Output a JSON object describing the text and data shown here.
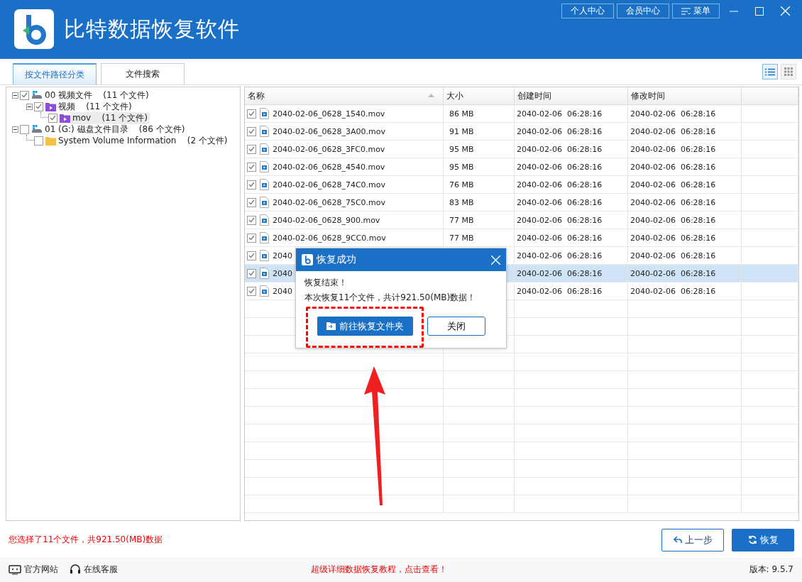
{
  "app": {
    "title": "比特数据恢复软件",
    "header_buttons": [
      "个人中心",
      "会员中心"
    ],
    "menu_button": "菜单"
  },
  "tabs": [
    {
      "label": "按文件路径分类",
      "selected": true
    },
    {
      "label": "文件搜索",
      "selected": false
    }
  ],
  "view_modes": [
    {
      "kind": "list",
      "selected": true
    },
    {
      "kind": "grid",
      "selected": false
    }
  ],
  "tree": [
    {
      "label": "00 视频文件",
      "count": "(11 个文件)",
      "kind": "drive",
      "checked": true,
      "expanded": true,
      "selected": false,
      "children": [
        {
          "label": "视频",
          "count": "(11 个文件)",
          "kind": "video",
          "checked": true,
          "expanded": true,
          "selected": false,
          "children": [
            {
              "label": "mov",
              "count": "(11 个文件)",
              "kind": "video",
              "checked": true,
              "selected": true
            }
          ]
        }
      ]
    },
    {
      "label": "01 (G:) 磁盘文件目录",
      "count": "(86 个文件)",
      "kind": "drive",
      "checked": false,
      "expanded": true,
      "selected": false,
      "children": [
        {
          "label": "System Volume Information",
          "count": "(2 个文件)",
          "kind": "folder",
          "checked": false,
          "selected": false
        }
      ]
    }
  ],
  "table": {
    "columns": [
      "名称",
      "大小",
      "创建时间",
      "修改时间"
    ],
    "rows": [
      {
        "name": "2040-02-06_0628_1540.mov",
        "size": "86 MB",
        "created": "2040-02-06  06:28:16",
        "modified": "2040-02-06  06:28:16",
        "checked": true,
        "selected": false
      },
      {
        "name": "2040-02-06_0628_3A00.mov",
        "size": "91 MB",
        "created": "2040-02-06  06:28:16",
        "modified": "2040-02-06  06:28:16",
        "checked": true,
        "selected": false
      },
      {
        "name": "2040-02-06_0628_3FC0.mov",
        "size": "95 MB",
        "created": "2040-02-06  06:28:16",
        "modified": "2040-02-06  06:28:16",
        "checked": true,
        "selected": false
      },
      {
        "name": "2040-02-06_0628_4540.mov",
        "size": "95 MB",
        "created": "2040-02-06  06:28:16",
        "modified": "2040-02-06  06:28:16",
        "checked": true,
        "selected": false
      },
      {
        "name": "2040-02-06_0628_74C0.mov",
        "size": "76 MB",
        "created": "2040-02-06  06:28:16",
        "modified": "2040-02-06  06:28:16",
        "checked": true,
        "selected": false
      },
      {
        "name": "2040-02-06_0628_75C0.mov",
        "size": "83 MB",
        "created": "2040-02-06  06:28:16",
        "modified": "2040-02-06  06:28:16",
        "checked": true,
        "selected": false
      },
      {
        "name": "2040-02-06_0628_900.mov",
        "size": "77 MB",
        "created": "2040-02-06  06:28:16",
        "modified": "2040-02-06  06:28:16",
        "checked": true,
        "selected": false
      },
      {
        "name": "2040-02-06_0628_9CC0.mov",
        "size": "77 MB",
        "created": "2040-02-06  06:28:16",
        "modified": "2040-02-06  06:28:16",
        "checked": true,
        "selected": false
      },
      {
        "name": "2040",
        "created": "2040-02-06  06:28:16",
        "modified": "2040-02-06  06:28:16",
        "checked": true,
        "selected": false
      },
      {
        "name": "2040",
        "created": "2040-02-06  06:28:16",
        "modified": "2040-02-06  06:28:16",
        "checked": true,
        "selected": true
      },
      {
        "name": "2040",
        "created": "2040-02-06  06:28:16",
        "modified": "2040-02-06  06:28:16",
        "checked": true,
        "selected": false
      }
    ]
  },
  "status": {
    "summary": "您选择了11个文件，共921.50(MB)数据",
    "back_button": "上一步",
    "recover_button": "恢复"
  },
  "footer": {
    "links": [
      "官方网站",
      "在线客服"
    ],
    "promo": "超级详细数据恢复教程，点击查看！",
    "version": "版本: 9.5.7"
  },
  "dialog": {
    "title": "恢复成功",
    "lines": [
      "恢复结束！",
      "本次恢复11个文件，共计921.50(MB)数据！"
    ],
    "primary_button": "前往恢复文件夹",
    "secondary_button": "关闭"
  }
}
